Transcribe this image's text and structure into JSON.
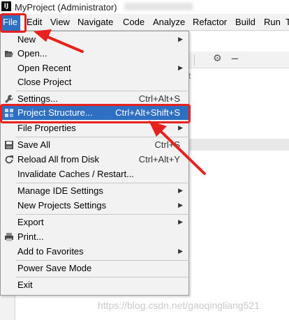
{
  "window": {
    "title": "MyProject (Administrator)",
    "app_icon_text": "IJ"
  },
  "menubar": {
    "items": [
      {
        "label": "File"
      },
      {
        "label": "Edit"
      },
      {
        "label": "View"
      },
      {
        "label": "Navigate"
      },
      {
        "label": "Code"
      },
      {
        "label": "Analyze"
      },
      {
        "label": "Refactor"
      },
      {
        "label": "Build"
      },
      {
        "label": "Run"
      },
      {
        "label": "T"
      }
    ]
  },
  "background": {
    "hint_text": "t"
  },
  "file_menu": {
    "items": [
      {
        "label": "New",
        "submenu": true
      },
      {
        "label": "Open...",
        "icon": "folder-open-icon"
      },
      {
        "label": "Open Recent",
        "submenu": true
      },
      {
        "label": "Close Project"
      },
      {
        "label": "Settings...",
        "shortcut": "Ctrl+Alt+S",
        "icon": "wrench-icon"
      },
      {
        "label": "Project Structure...",
        "shortcut": "Ctrl+Alt+Shift+S",
        "icon": "project-structure-icon",
        "selected": true
      },
      {
        "label": "File Properties",
        "submenu": true
      },
      {
        "label": "Save All",
        "shortcut": "Ctrl+S",
        "icon": "save-icon"
      },
      {
        "label": "Reload All from Disk",
        "shortcut": "Ctrl+Alt+Y",
        "icon": "reload-icon"
      },
      {
        "label": "Invalidate Caches / Restart..."
      },
      {
        "label": "Manage IDE Settings",
        "submenu": true
      },
      {
        "label": "New Projects Settings",
        "submenu": true
      },
      {
        "label": "Export",
        "submenu": true
      },
      {
        "label": "Print...",
        "icon": "print-icon"
      },
      {
        "label": "Add to Favorites",
        "submenu": true
      },
      {
        "label": "Power Save Mode"
      },
      {
        "label": "Exit"
      }
    ]
  },
  "watermark": "https://blog.csdn.net/gaoqingliang521",
  "colors": {
    "highlight": "#2e6fc2",
    "annotation": "#e8211e",
    "menu_bg": "#f2f2f2"
  }
}
